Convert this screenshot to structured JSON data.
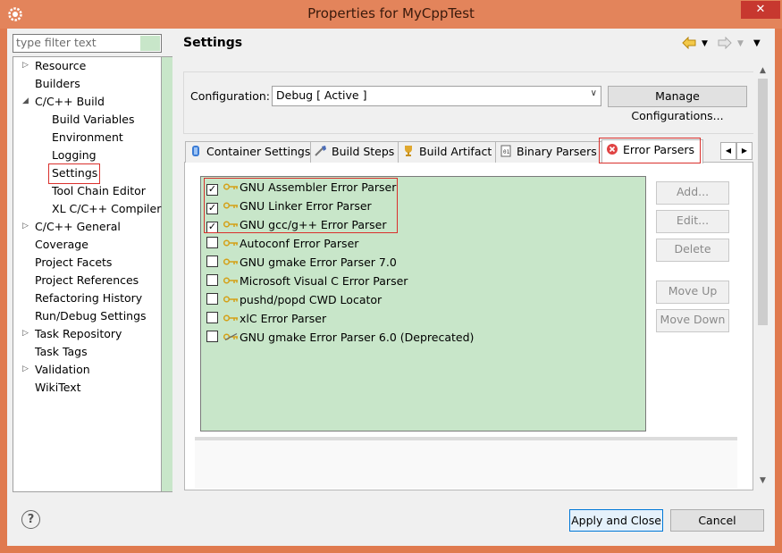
{
  "window": {
    "title": "Properties for MyCppTest",
    "close_glyph": "✕",
    "titlebar_color": "#e3845b"
  },
  "filter": {
    "placeholder": "type filter text"
  },
  "tree": [
    {
      "label": "Resource",
      "arrow": "▷"
    },
    {
      "label": "Builders",
      "arrow": ""
    },
    {
      "label": "C/C++ Build",
      "arrow": "◢"
    },
    {
      "label": "Build Variables",
      "arrow": ""
    },
    {
      "label": "Environment",
      "arrow": ""
    },
    {
      "label": "Logging",
      "arrow": ""
    },
    {
      "label": "Settings",
      "arrow": "",
      "selected": true
    },
    {
      "label": "Tool Chain Editor",
      "arrow": ""
    },
    {
      "label": "XL C/C++ Compiler",
      "arrow": ""
    },
    {
      "label": "C/C++ General",
      "arrow": "▷"
    },
    {
      "label": "Coverage",
      "arrow": ""
    },
    {
      "label": "Project Facets",
      "arrow": ""
    },
    {
      "label": "Project References",
      "arrow": ""
    },
    {
      "label": "Refactoring History",
      "arrow": ""
    },
    {
      "label": "Run/Debug Settings",
      "arrow": ""
    },
    {
      "label": "Task Repository",
      "arrow": "▷"
    },
    {
      "label": "Task Tags",
      "arrow": ""
    },
    {
      "label": "Validation",
      "arrow": "▷"
    },
    {
      "label": "WikiText",
      "arrow": ""
    }
  ],
  "page": {
    "title": "Settings"
  },
  "config": {
    "label": "Configuration:",
    "value": "Debug  [ Active ]",
    "manage_label": "Manage Configurations..."
  },
  "tabs": [
    {
      "label": "Container Settings",
      "icon": "container-icon"
    },
    {
      "label": "Build Steps",
      "icon": "build-steps-icon"
    },
    {
      "label": "Build Artifact",
      "icon": "build-artifact-icon"
    },
    {
      "label": "Binary Parsers",
      "icon": "binary-parsers-icon"
    },
    {
      "label": "Error Parsers",
      "icon": "error-icon",
      "active": true
    }
  ],
  "parsers": [
    {
      "label": "GNU Assembler Error Parser",
      "checked": true
    },
    {
      "label": "GNU Linker Error Parser",
      "checked": true
    },
    {
      "label": "GNU gcc/g++ Error Parser",
      "checked": true
    },
    {
      "label": "Autoconf Error Parser",
      "checked": false
    },
    {
      "label": "GNU gmake Error Parser 7.0",
      "checked": false
    },
    {
      "label": "Microsoft Visual C Error Parser",
      "checked": false
    },
    {
      "label": "pushd/popd CWD Locator",
      "checked": false
    },
    {
      "label": "xlC Error Parser",
      "checked": false
    },
    {
      "label": "GNU gmake Error Parser 6.0 (Deprecated)",
      "checked": false,
      "deprecated": true
    }
  ],
  "side_buttons": {
    "add": "Add...",
    "edit": "Edit...",
    "delete": "Delete",
    "move_up": "Move Up",
    "move_down": "Move Down"
  },
  "footer": {
    "help": "?",
    "apply_close": "Apply and Close",
    "cancel": "Cancel"
  },
  "colors": {
    "highlight": "#c8e6c9",
    "annotation_red": "#d9302c",
    "key_icon": "#d4a017"
  }
}
